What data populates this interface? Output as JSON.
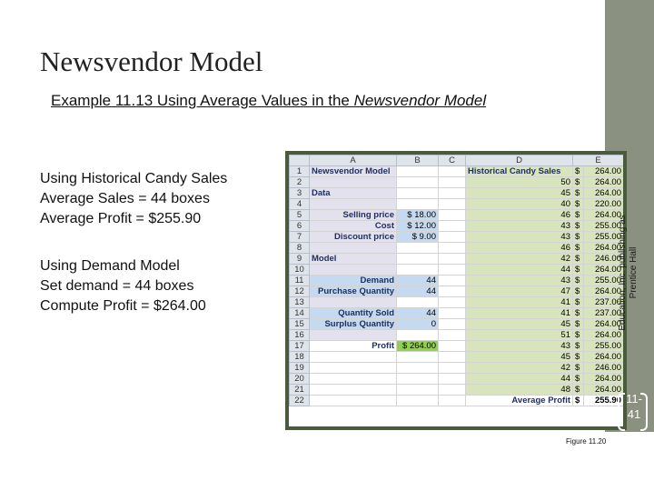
{
  "slide": {
    "title": "Newsvendor Model",
    "subtitle_prefix": "Example 11.13  Using Average Values in the ",
    "subtitle_italic": "Newsvendor Model",
    "historical_lines": [
      "Using Historical Candy Sales",
      "Average Sales = 44 boxes",
      "Average Profit = $255.90"
    ],
    "demand_lines": [
      "Using Demand Model",
      "Set demand = 44 boxes",
      "Compute Profit = $264.00"
    ],
    "copyright_line1": "Education, Inc. publishing as",
    "copyright_line2": "Prentice Hall",
    "slide_number_line1": "11-",
    "slide_number_line2": "41",
    "figure_caption": "Figure 11.20"
  },
  "sheet": {
    "columns": [
      "A",
      "B",
      "C",
      "D",
      "E"
    ],
    "rows": [
      {
        "n": "1",
        "a": "Newsvendor Model",
        "b": "",
        "d": "Historical Candy Sales",
        "e1": "$",
        "e2": "264.00"
      },
      {
        "n": "2",
        "a": "",
        "b": "",
        "d": "50",
        "e1": "$",
        "e2": "264.00"
      },
      {
        "n": "3",
        "a": "Data",
        "b": "",
        "d": "45",
        "e1": "$",
        "e2": "264.00"
      },
      {
        "n": "4",
        "a": "",
        "b": "",
        "d": "40",
        "e1": "$",
        "e2": "220.00"
      },
      {
        "n": "5",
        "a": "Selling price",
        "b": "$  18.00",
        "d": "46",
        "e1": "$",
        "e2": "264.00"
      },
      {
        "n": "6",
        "a": "Cost",
        "b": "$  12.00",
        "d": "43",
        "e1": "$",
        "e2": "255.00"
      },
      {
        "n": "7",
        "a": "Discount price",
        "b": "$    9.00",
        "d": "43",
        "e1": "$",
        "e2": "255.00"
      },
      {
        "n": "8",
        "a": "",
        "b": "",
        "d": "46",
        "e1": "$",
        "e2": "264.00"
      },
      {
        "n": "9",
        "a": "Model",
        "b": "",
        "d": "42",
        "e1": "$",
        "e2": "246.00"
      },
      {
        "n": "10",
        "a": "",
        "b": "",
        "d": "44",
        "e1": "$",
        "e2": "264.00"
      },
      {
        "n": "11",
        "a": "Demand",
        "b": "44",
        "d": "43",
        "e1": "$",
        "e2": "255.00"
      },
      {
        "n": "12",
        "a": "Purchase Quantity",
        "b": "44",
        "d": "47",
        "e1": "$",
        "e2": "264.00"
      },
      {
        "n": "13",
        "a": "",
        "b": "",
        "d": "41",
        "e1": "$",
        "e2": "237.00"
      },
      {
        "n": "14",
        "a": "Quantity Sold",
        "b": "44",
        "d": "41",
        "e1": "$",
        "e2": "237.00"
      },
      {
        "n": "15",
        "a": "Surplus Quantity",
        "b": "0",
        "d": "45",
        "e1": "$",
        "e2": "264.00"
      },
      {
        "n": "16",
        "a": "",
        "b": "",
        "d": "51",
        "e1": "$",
        "e2": "264.00"
      },
      {
        "n": "17",
        "a": "Profit",
        "b": "$ 264.00",
        "d": "43",
        "e1": "$",
        "e2": "255.00"
      },
      {
        "n": "18",
        "a": "",
        "b": "",
        "d": "45",
        "e1": "$",
        "e2": "264.00"
      },
      {
        "n": "19",
        "a": "",
        "b": "",
        "d": "42",
        "e1": "$",
        "e2": "246.00"
      },
      {
        "n": "20",
        "a": "",
        "b": "",
        "d": "44",
        "e1": "$",
        "e2": "264.00"
      },
      {
        "n": "21",
        "a": "",
        "b": "",
        "d": "48",
        "e1": "$",
        "e2": "264.00"
      },
      {
        "n": "22",
        "a": "",
        "b": "",
        "d": "Average Profit",
        "e1": "$",
        "e2": "255.90"
      }
    ]
  }
}
